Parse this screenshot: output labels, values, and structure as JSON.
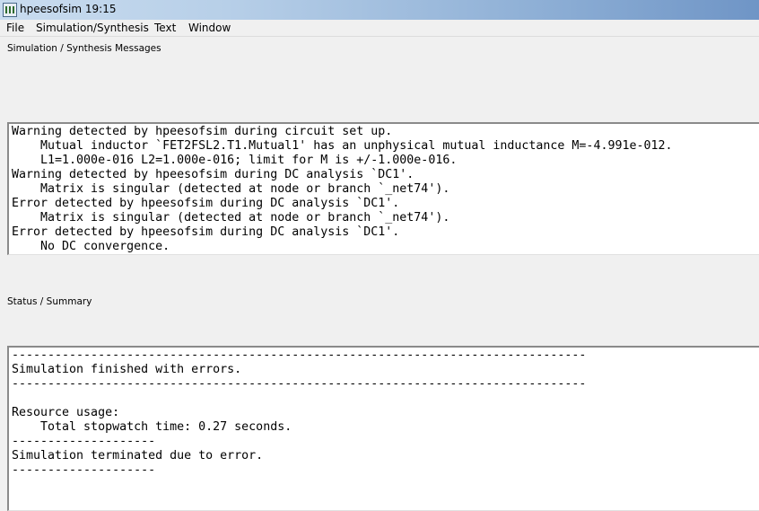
{
  "window": {
    "title": "hpeesofsim 19:15"
  },
  "menu": {
    "items": [
      "File",
      "Simulation/Synthesis",
      "Text",
      "Window"
    ]
  },
  "messages": {
    "label": "Simulation / Synthesis Messages",
    "lines": [
      "Warning detected by hpeesofsim during circuit set up.",
      "    Mutual inductor `FET2FSL2.T1.Mutual1' has an unphysical mutual inductance M=-4.991e-012.",
      "    L1=1.000e-016 L2=1.000e-016; limit for M is +/-1.000e-016.",
      "Warning detected by hpeesofsim during DC analysis `DC1'.",
      "    Matrix is singular (detected at node or branch `_net74').",
      "Error detected by hpeesofsim during DC analysis `DC1'.",
      "    Matrix is singular (detected at node or branch `_net74').",
      "Error detected by hpeesofsim during DC analysis `DC1'.",
      "    No DC convergence."
    ]
  },
  "status": {
    "label": "Status / Summary",
    "lines": [
      "--------------------------------------------------------------------------------",
      "Simulation finished with errors.",
      "--------------------------------------------------------------------------------",
      "",
      "Resource usage:",
      "    Total stopwatch time: 0.27 seconds.",
      "--------------------",
      "Simulation terminated due to error.",
      "--------------------"
    ]
  }
}
